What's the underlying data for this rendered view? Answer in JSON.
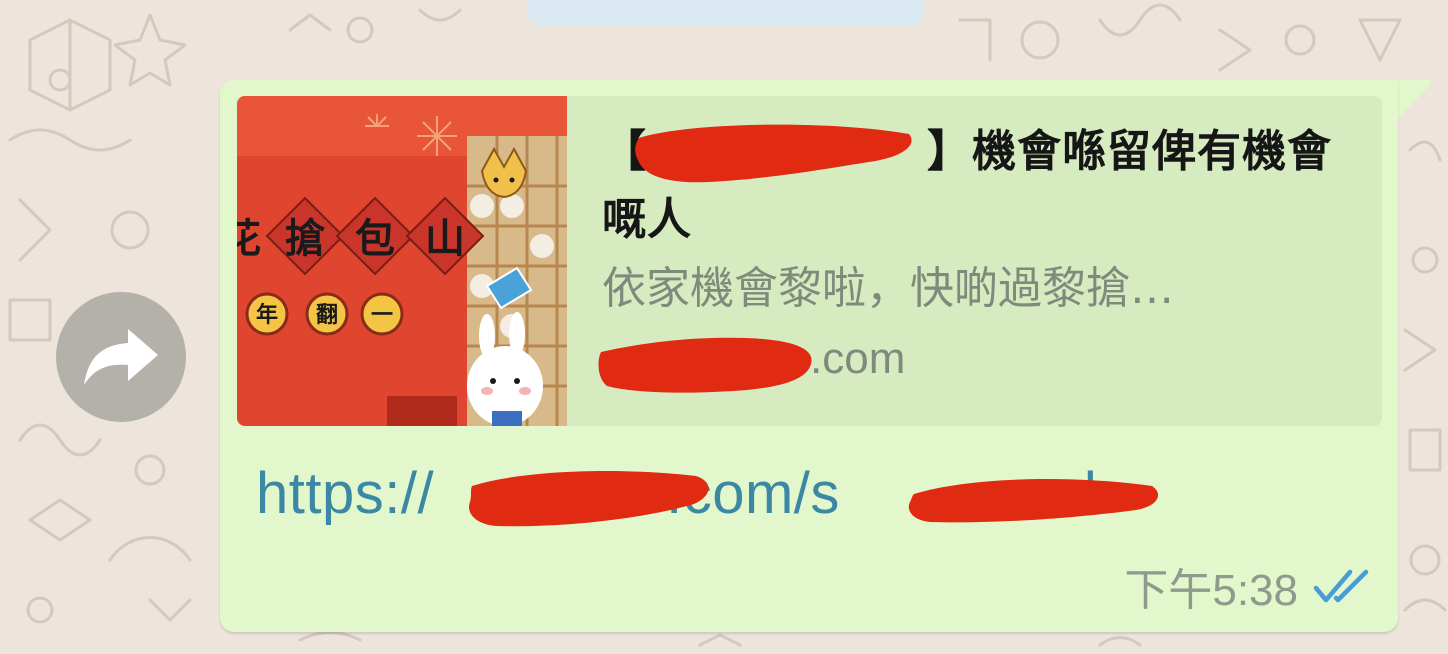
{
  "message": {
    "preview": {
      "title_open": "【",
      "title_close": "】機會喺留俾有機會嘅人",
      "description": "依家機會黎啦，快啲過黎搶…",
      "domain_suffix": ".com"
    },
    "link": {
      "scheme": "https://",
      "middle": ".com/s",
      "tail": "k"
    },
    "timestamp": "下午5:38",
    "status_icon": "double-check-icon"
  },
  "colors": {
    "bubble": "#e2f7cb",
    "link": "#3b88a4",
    "redaction": "#e02a12",
    "read_ticks": "#4a9cd6"
  },
  "actions": {
    "forward_icon": "forward-arrow-icon"
  }
}
